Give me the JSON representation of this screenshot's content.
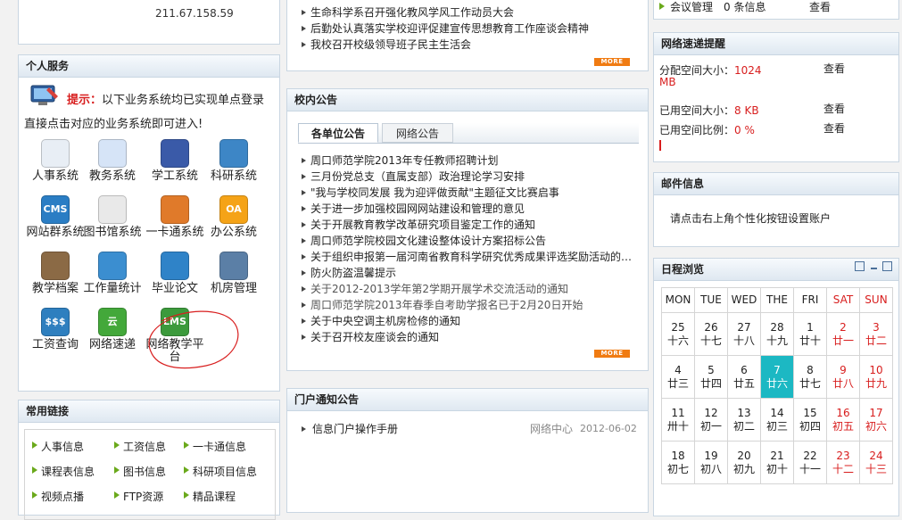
{
  "top_left": {
    "ip": "211.67.158.59"
  },
  "personal": {
    "title": "个人服务",
    "tip_label": "提示：",
    "tip_line1": "以下业务系统均已实现单点登录",
    "tip_line2": "直接点击对应的业务系统即可进入!",
    "systems": [
      {
        "label": "人事系统",
        "icon": "people-icon",
        "color": "#e8eef5"
      },
      {
        "label": "教务系统",
        "icon": "pencil-doc-icon",
        "color": "#d6e4f7"
      },
      {
        "label": "学工系统",
        "icon": "puzzle-icon",
        "color": "#3a5aa8"
      },
      {
        "label": "科研系统",
        "icon": "microscope-icon",
        "color": "#3d86c6"
      },
      {
        "label": "网站群系统",
        "icon": "cms-icon",
        "color": "#2a7dc4"
      },
      {
        "label": "图书馆系统",
        "icon": "books-icon",
        "color": "#e9e9e9"
      },
      {
        "label": "一卡通系统",
        "icon": "card-icon",
        "color": "#e07a2a"
      },
      {
        "label": "办公系统",
        "icon": "oa-icon",
        "color": "#f5a317"
      },
      {
        "label": "教学档案",
        "icon": "archive-icon",
        "color": "#8b6a45"
      },
      {
        "label": "工作量统计",
        "icon": "globe-icon",
        "color": "#3b8ed0"
      },
      {
        "label": "毕业论文",
        "icon": "folder-icon",
        "color": "#2f83c8"
      },
      {
        "label": "机房管理",
        "icon": "monitor-icon",
        "color": "#5b7fa6"
      },
      {
        "label": "工资查询",
        "icon": "salary-icon",
        "color": "#2e7fbf"
      },
      {
        "label": "网络速递",
        "icon": "cloud-icon",
        "color": "#43a83a"
      },
      {
        "label": "网络教学平台",
        "icon": "lms-icon",
        "color": "#3c9a3c"
      }
    ]
  },
  "links": {
    "title": "常用链接",
    "items": [
      "人事信息",
      "工资信息",
      "一卡通信息",
      "课程表信息",
      "图书信息",
      "科研项目信息",
      "视频点播",
      "FTP资源",
      "精品课程"
    ]
  },
  "news": {
    "items": [
      "生命科学系召开强化教风学风工作动员大会",
      "后勤处认真落实学校迎评促建宣传思想教育工作座谈会精神",
      "我校召开校级领导班子民主生活会"
    ],
    "more": "MORE"
  },
  "notice": {
    "title": "校内公告",
    "tabs": [
      "各单位公告",
      "网络公告"
    ],
    "items": [
      {
        "text": "周口师范学院2013年专任教师招聘计划",
        "gray": false
      },
      {
        "text": "三月份党总支（直属支部）政治理论学习安排",
        "gray": false
      },
      {
        "text": "\"我与学校同发展 我为迎评做贡献\"主题征文比赛启事",
        "gray": false
      },
      {
        "text": "关于进一步加强校园网网站建设和管理的意见",
        "gray": false
      },
      {
        "text": "关于开展教育教学改革研究项目鉴定工作的通知",
        "gray": false
      },
      {
        "text": "周口师范学院校园文化建设整体设计方案招标公告",
        "gray": false
      },
      {
        "text": "关于组织申报第一届河南省教育科学研究优秀成果评选奖励活动的通...",
        "gray": false
      },
      {
        "text": "防火防盗温馨提示",
        "gray": false
      },
      {
        "text": "关于2012-2013学年第2学期开展学术交流活动的通知",
        "gray": true
      },
      {
        "text": "周口师范学院2013年春季自考助学报名已于2月20日开始",
        "gray": true
      },
      {
        "text": "关于中央空调主机房检修的通知",
        "gray": false
      },
      {
        "text": "关于召开校友座谈会的通知",
        "gray": false
      }
    ],
    "more": "MORE"
  },
  "portal": {
    "title": "门户通知公告",
    "items": [
      {
        "text": "信息门户操作手册",
        "source": "网络中心",
        "date": "2012-06-02"
      }
    ]
  },
  "meeting": {
    "label": "会议管理",
    "count": "0 条信息",
    "view": "查看"
  },
  "netdrive": {
    "title": "网络速递提醒",
    "rows": [
      {
        "label": "分配空间大小：",
        "value": "1024",
        "value2": "MB",
        "view": "查看"
      },
      {
        "label": "已用空间大小：",
        "value": "8 KB",
        "value2": "",
        "view": "查看"
      },
      {
        "label": "已用空间比例：",
        "value": "0 %",
        "value2": "",
        "view": "查看"
      }
    ]
  },
  "mail": {
    "title": "邮件信息",
    "text": "请点击右上角个性化按钮设置账户"
  },
  "calendar": {
    "title": "日程浏览",
    "headers": [
      "MON",
      "TUE",
      "WED",
      "THE",
      "FRI",
      "SAT",
      "SUN"
    ],
    "weeks": [
      [
        [
          "25",
          "十六"
        ],
        [
          "26",
          "十七"
        ],
        [
          "27",
          "十八"
        ],
        [
          "28",
          "十九"
        ],
        [
          "1",
          "廿十"
        ],
        [
          "2",
          "廿一"
        ],
        [
          "3",
          "廿二"
        ]
      ],
      [
        [
          "4",
          "廿三"
        ],
        [
          "5",
          "廿四"
        ],
        [
          "6",
          "廿五"
        ],
        [
          "7",
          "廿六"
        ],
        [
          "8",
          "廿七"
        ],
        [
          "9",
          "廿八"
        ],
        [
          "10",
          "廿九"
        ]
      ],
      [
        [
          "11",
          "卅十"
        ],
        [
          "12",
          "初一"
        ],
        [
          "13",
          "初二"
        ],
        [
          "14",
          "初三"
        ],
        [
          "15",
          "初四"
        ],
        [
          "16",
          "初五"
        ],
        [
          "17",
          "初六"
        ]
      ],
      [
        [
          "18",
          "初七"
        ],
        [
          "19",
          "初八"
        ],
        [
          "20",
          "初九"
        ],
        [
          "21",
          "初十"
        ],
        [
          "22",
          "十一"
        ],
        [
          "23",
          "十二"
        ],
        [
          "24",
          "十三"
        ]
      ]
    ],
    "today": "7"
  },
  "colors": {
    "accent_red": "#d81e1e",
    "today_bg": "#1cb8c3",
    "more_orange": "#f07b12",
    "link_green": "#6aa91b"
  }
}
